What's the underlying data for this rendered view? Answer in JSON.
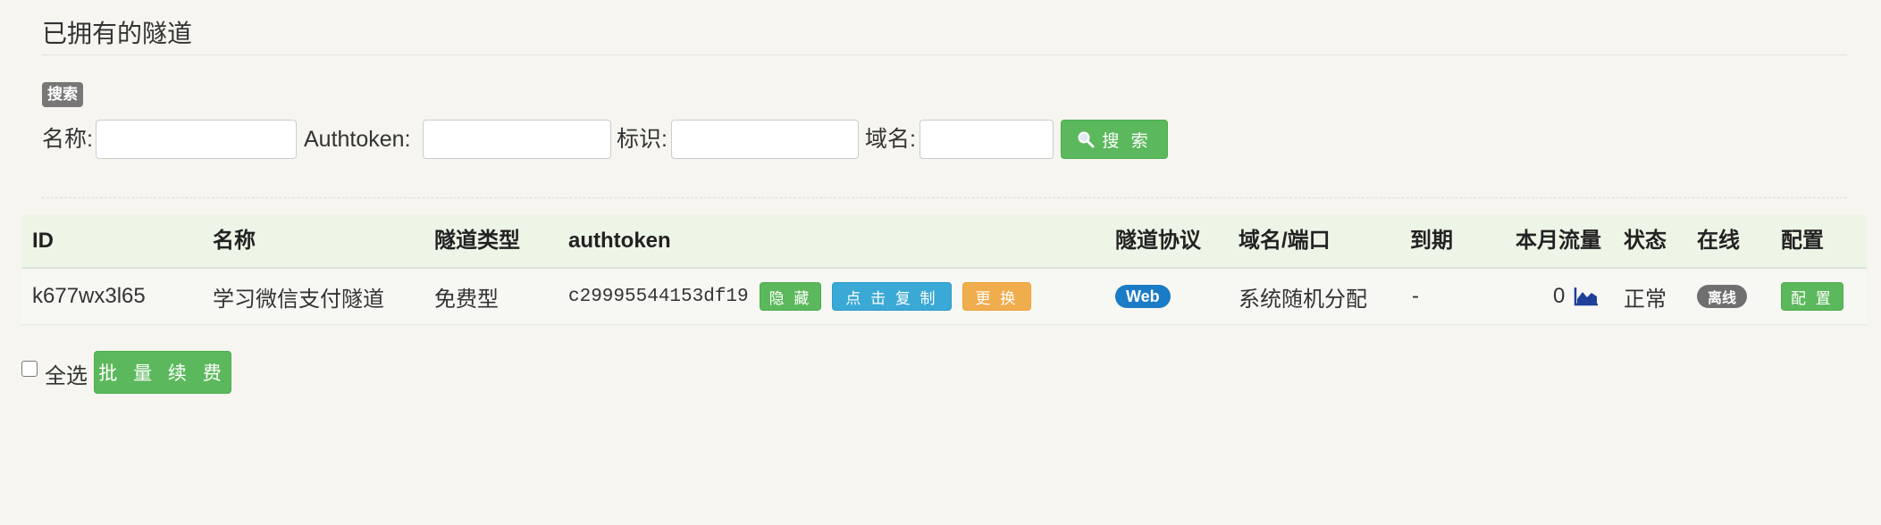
{
  "page": {
    "title": "已拥有的隧道"
  },
  "search": {
    "badge": "搜索",
    "name_label": "名称:",
    "authtoken_label": "Authtoken:",
    "tag_label": "标识:",
    "domain_label": "域名:",
    "name_value": "",
    "authtoken_value": "",
    "tag_value": "",
    "domain_value": "",
    "button_label": "搜 索",
    "button_icon": "magnifier-icon"
  },
  "table": {
    "headers": {
      "id": "ID",
      "name": "名称",
      "type": "隧道类型",
      "authtoken": "authtoken",
      "protocol": "隧道协议",
      "domain": "域名/端口",
      "expire": "到期",
      "traffic": "本月流量",
      "status": "状态",
      "online": "在线",
      "config": "配置"
    },
    "rows": [
      {
        "id": "k677wx3l65",
        "name": "学习微信支付隧道",
        "type": "免费型",
        "authtoken": "c29995544153df19",
        "hide_label": "隐 藏",
        "copy_label": "点 击 复 制",
        "change_label": "更 换",
        "protocol": "Web",
        "domain": "系统随机分配",
        "expire": "-",
        "traffic": "0",
        "traffic_icon": "area-chart-icon",
        "status": "正常",
        "online": "离线",
        "config_label": "配 置"
      }
    ]
  },
  "footer": {
    "select_all_label": "全选",
    "select_all_checked": false,
    "batch_renew_label": "批 量 续 费"
  },
  "colors": {
    "success": "#5cb85c",
    "info": "#3aa9d6",
    "warning": "#f0ad4e",
    "badge_blue": "#1a7bc6",
    "badge_gray": "#6f6f6f",
    "header_bg": "#edf5e6"
  }
}
